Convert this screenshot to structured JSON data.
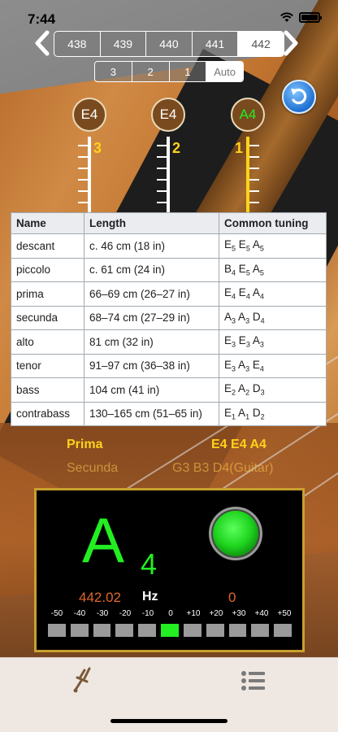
{
  "status_bar": {
    "time": "7:44"
  },
  "reference_frequencies": {
    "options": [
      "438",
      "439",
      "440",
      "441",
      "442"
    ],
    "selected": "442"
  },
  "string_modes": {
    "options": [
      "3",
      "2",
      "1",
      "Auto"
    ],
    "selected": "Auto"
  },
  "strings": [
    {
      "note": "E4",
      "number": "3",
      "active": false
    },
    {
      "note": "E4",
      "number": "2",
      "active": false
    },
    {
      "note": "A4",
      "number": "1",
      "active": true
    }
  ],
  "table": {
    "headers": [
      "Name",
      "Length",
      "Common tuning"
    ],
    "rows": [
      {
        "name": "descant",
        "length": "c. 46 cm (18 in)",
        "tuning": [
          [
            "E",
            "5"
          ],
          [
            "E",
            "5"
          ],
          [
            "A",
            "5"
          ]
        ]
      },
      {
        "name": "piccolo",
        "length": "c. 61 cm (24 in)",
        "tuning": [
          [
            "B",
            "4"
          ],
          [
            "E",
            "5"
          ],
          [
            "A",
            "5"
          ]
        ]
      },
      {
        "name": "prima",
        "length": "66–69 cm (26–27 in)",
        "tuning": [
          [
            "E",
            "4"
          ],
          [
            "E",
            "4"
          ],
          [
            "A",
            "4"
          ]
        ]
      },
      {
        "name": "secunda",
        "length": "68–74 cm (27–29 in)",
        "tuning": [
          [
            "A",
            "3"
          ],
          [
            "A",
            "3"
          ],
          [
            "D",
            "4"
          ]
        ]
      },
      {
        "name": "alto",
        "length": "81 cm (32 in)",
        "tuning": [
          [
            "E",
            "3"
          ],
          [
            "E",
            "3"
          ],
          [
            "A",
            "3"
          ]
        ]
      },
      {
        "name": "tenor",
        "length": "91–97 cm (36–38 in)",
        "tuning": [
          [
            "E",
            "3"
          ],
          [
            "A",
            "3"
          ],
          [
            "E",
            "4"
          ]
        ]
      },
      {
        "name": "bass",
        "length": "104 cm (41 in)",
        "tuning": [
          [
            "E",
            "2"
          ],
          [
            "A",
            "2"
          ],
          [
            "D",
            "3"
          ]
        ]
      },
      {
        "name": "contrabass",
        "length": "130–165 cm (51–65 in)",
        "tuning": [
          [
            "E",
            "1"
          ],
          [
            "A",
            "1"
          ],
          [
            "D",
            "2"
          ]
        ]
      }
    ]
  },
  "instrument": {
    "current_name": "Prima",
    "current_notes": "E4 E4 A4",
    "next_name": "Secunda",
    "next_notes": "G3 B3 D4(Guitar)"
  },
  "tuner": {
    "note": "A",
    "octave": "4",
    "frequency": "442.02",
    "unit": "Hz",
    "cents": "0",
    "scale_labels": [
      "-50",
      "-40",
      "-30",
      "-20",
      "-10",
      "0",
      "+10",
      "+20",
      "+30",
      "+40",
      "+50"
    ],
    "scale_active_index": 5,
    "colors": {
      "note": "#22ee22",
      "readout": "#e0662a",
      "frame": "#c9a030"
    }
  },
  "tabbar": {
    "items": [
      {
        "icon": "tuning-fork-icon"
      },
      {
        "icon": "list-icon"
      }
    ]
  }
}
